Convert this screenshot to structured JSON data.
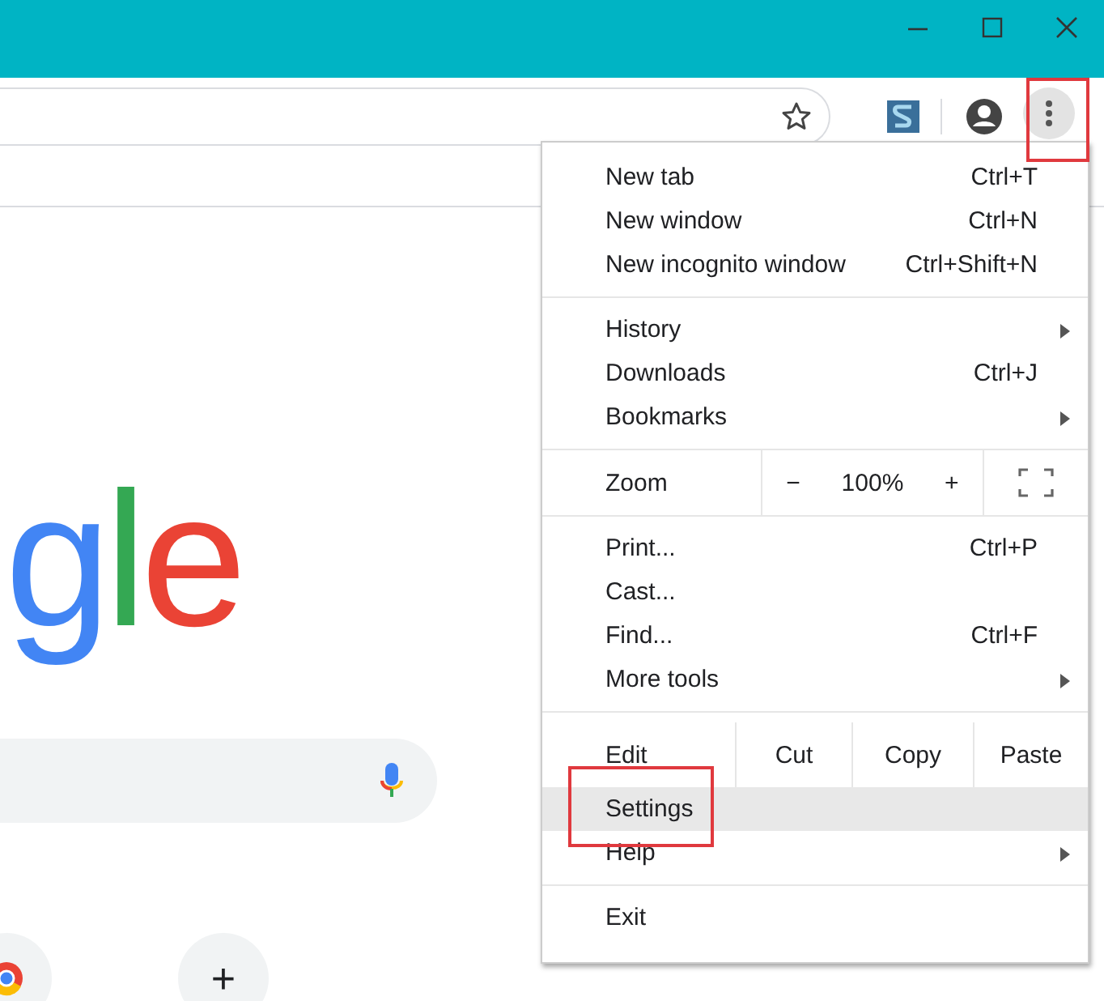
{
  "window": {
    "controls": [
      {
        "kind": "minimize"
      },
      {
        "kind": "maximize"
      },
      {
        "kind": "close"
      }
    ]
  },
  "toolbar": {
    "menu_button": {
      "highlighted": true
    }
  },
  "page": {
    "logo": [
      {
        "text": "g",
        "color": "#4285f4"
      },
      {
        "text": "l",
        "color": "#34a853"
      },
      {
        "text": "e",
        "color": "#ea4335"
      }
    ],
    "shortcuts": [
      {
        "kind": "site"
      },
      {
        "kind": "add",
        "label": "+"
      }
    ]
  },
  "menu": {
    "sections": [
      {
        "items": [
          {
            "kind": "item",
            "label": "New tab",
            "shortcut": "Ctrl+T",
            "submenu": false,
            "selected": false
          },
          {
            "kind": "item",
            "label": "New window",
            "shortcut": "Ctrl+N",
            "submenu": false,
            "selected": false
          },
          {
            "kind": "item",
            "label": "New incognito window",
            "shortcut": "Ctrl+Shift+N",
            "submenu": false,
            "selected": false
          }
        ]
      },
      {
        "items": [
          {
            "kind": "item",
            "label": "History",
            "submenu": true,
            "selected": false
          },
          {
            "kind": "item",
            "label": "Downloads",
            "shortcut": "Ctrl+J",
            "submenu": false,
            "selected": false
          },
          {
            "kind": "item",
            "label": "Bookmarks",
            "submenu": true,
            "selected": false
          }
        ]
      },
      {
        "items": [
          {
            "kind": "zoom",
            "label": "Zoom",
            "minus": "−",
            "value": "100%",
            "plus": "+"
          }
        ]
      },
      {
        "items": [
          {
            "kind": "item",
            "label": "Print...",
            "shortcut": "Ctrl+P",
            "submenu": false,
            "selected": false
          },
          {
            "kind": "item",
            "label": "Cast...",
            "submenu": false,
            "selected": false
          },
          {
            "kind": "item",
            "label": "Find...",
            "shortcut": "Ctrl+F",
            "submenu": false,
            "selected": false
          },
          {
            "kind": "item",
            "label": "More tools",
            "submenu": true,
            "selected": false
          }
        ]
      },
      {
        "items": [
          {
            "kind": "edit",
            "label": "Edit",
            "buttons": [
              "Cut",
              "Copy",
              "Paste"
            ]
          },
          {
            "kind": "item",
            "label": "Settings",
            "submenu": false,
            "selected": true,
            "highlighted": true
          },
          {
            "kind": "item",
            "label": "Help",
            "submenu": true,
            "selected": false
          }
        ]
      },
      {
        "items": [
          {
            "kind": "item",
            "label": "Exit",
            "submenu": false,
            "selected": false
          }
        ]
      }
    ]
  }
}
